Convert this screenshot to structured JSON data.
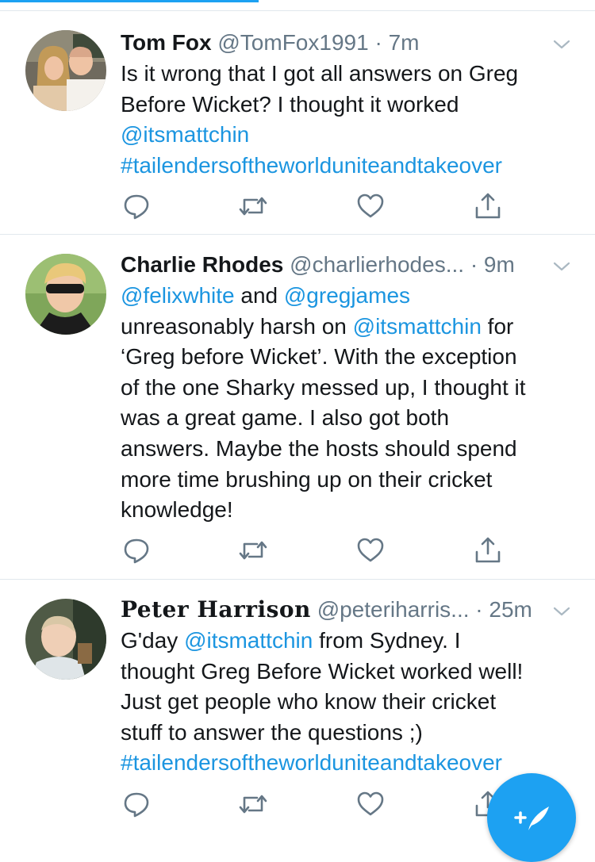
{
  "tweets": [
    {
      "name": "Tom Fox",
      "handle": "@TomFox1991",
      "separator": "·",
      "time": "7m",
      "lines": [
        [
          {
            "t": "Is it wrong that I got all answers on Greg"
          }
        ],
        [
          {
            "t": "Before Wicket? I thought it worked"
          }
        ],
        [
          {
            "t": "@itsmattchin",
            "link": true
          }
        ],
        [
          {
            "t": "#tailendersoftheworlduniteandtakeover",
            "link": true
          }
        ]
      ]
    },
    {
      "name": "Charlie Rhodes",
      "handle": "@charlierhodes...",
      "separator": "·",
      "time": "9m",
      "lines": [
        [
          {
            "t": "@felixwhite",
            "link": true
          },
          {
            "t": " and "
          },
          {
            "t": "@gregjames",
            "link": true
          }
        ],
        [
          {
            "t": "unreasonably harsh on "
          },
          {
            "t": "@itsmattchin",
            "link": true
          },
          {
            "t": " for"
          }
        ],
        [
          {
            "t": "‘Greg before Wicket’. With the exception"
          }
        ],
        [
          {
            "t": "of the one Sharky messed up, I thought it"
          }
        ],
        [
          {
            "t": "was a great game. I also got both"
          }
        ],
        [
          {
            "t": "answers. Maybe the hosts should spend"
          }
        ],
        [
          {
            "t": "more time brushing up on their cricket"
          }
        ],
        [
          {
            "t": "knowledge!"
          }
        ]
      ]
    },
    {
      "name": "Peter Harrison",
      "handle": "@peteriharris...",
      "separator": "·",
      "time": "25m",
      "lines": [
        [
          {
            "t": "G'day "
          },
          {
            "t": "@itsmattchin",
            "link": true
          },
          {
            "t": " from Sydney. I"
          }
        ],
        [
          {
            "t": "thought Greg Before Wicket worked well!"
          }
        ],
        [
          {
            "t": "Just get people who know their cricket"
          }
        ],
        [
          {
            "t": "stuff to answer the questions ;)"
          }
        ],
        [
          {
            "t": "#tailendersoftheworlduniteandtakeover",
            "link": true
          }
        ]
      ]
    }
  ],
  "icons": {
    "reply": "reply-icon",
    "retweet": "retweet-icon",
    "like": "heart-icon",
    "share": "share-icon",
    "caret": "chevron-down-icon",
    "compose": "compose-tweet-icon"
  },
  "colors": {
    "accent": "#1da1f2",
    "link": "#1b95e0",
    "muted": "#657786",
    "divider": "#e1e8ed"
  }
}
